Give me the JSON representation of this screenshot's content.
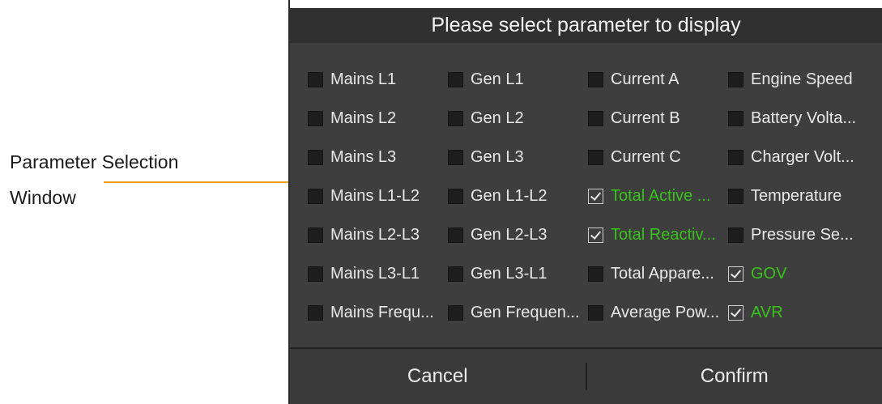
{
  "annotation": {
    "line1": "Parameter Selection",
    "line2": "Window",
    "arrow_color": "#f0a020"
  },
  "dialog": {
    "title": "Please select parameter to display",
    "cancel_label": "Cancel",
    "confirm_label": "Confirm",
    "selected_color": "#38c21b",
    "rows": [
      [
        {
          "label": "Mains L1",
          "checked": false
        },
        {
          "label": "Gen L1",
          "checked": false
        },
        {
          "label": "Current A",
          "checked": false
        },
        {
          "label": "Engine Speed",
          "checked": false
        }
      ],
      [
        {
          "label": "Mains L2",
          "checked": false
        },
        {
          "label": "Gen L2",
          "checked": false
        },
        {
          "label": "Current B",
          "checked": false
        },
        {
          "label": "Battery Volta...",
          "checked": false
        }
      ],
      [
        {
          "label": "Mains L3",
          "checked": false
        },
        {
          "label": "Gen L3",
          "checked": false
        },
        {
          "label": "Current C",
          "checked": false
        },
        {
          "label": "Charger Volt...",
          "checked": false
        }
      ],
      [
        {
          "label": "Mains L1-L2",
          "checked": false
        },
        {
          "label": "Gen L1-L2",
          "checked": false
        },
        {
          "label": "Total Active ...",
          "checked": true
        },
        {
          "label": "Temperature",
          "checked": false
        }
      ],
      [
        {
          "label": "Mains L2-L3",
          "checked": false
        },
        {
          "label": "Gen L2-L3",
          "checked": false
        },
        {
          "label": "Total Reactiv...",
          "checked": true
        },
        {
          "label": "Pressure Se...",
          "checked": false
        }
      ],
      [
        {
          "label": "Mains L3-L1",
          "checked": false
        },
        {
          "label": "Gen L3-L1",
          "checked": false
        },
        {
          "label": "Total Appare...",
          "checked": false
        },
        {
          "label": "GOV",
          "checked": true
        }
      ],
      [
        {
          "label": "Mains Frequ...",
          "checked": false
        },
        {
          "label": "Gen Frequen...",
          "checked": false
        },
        {
          "label": "Average Pow...",
          "checked": false
        },
        {
          "label": "AVR",
          "checked": true
        }
      ]
    ]
  }
}
